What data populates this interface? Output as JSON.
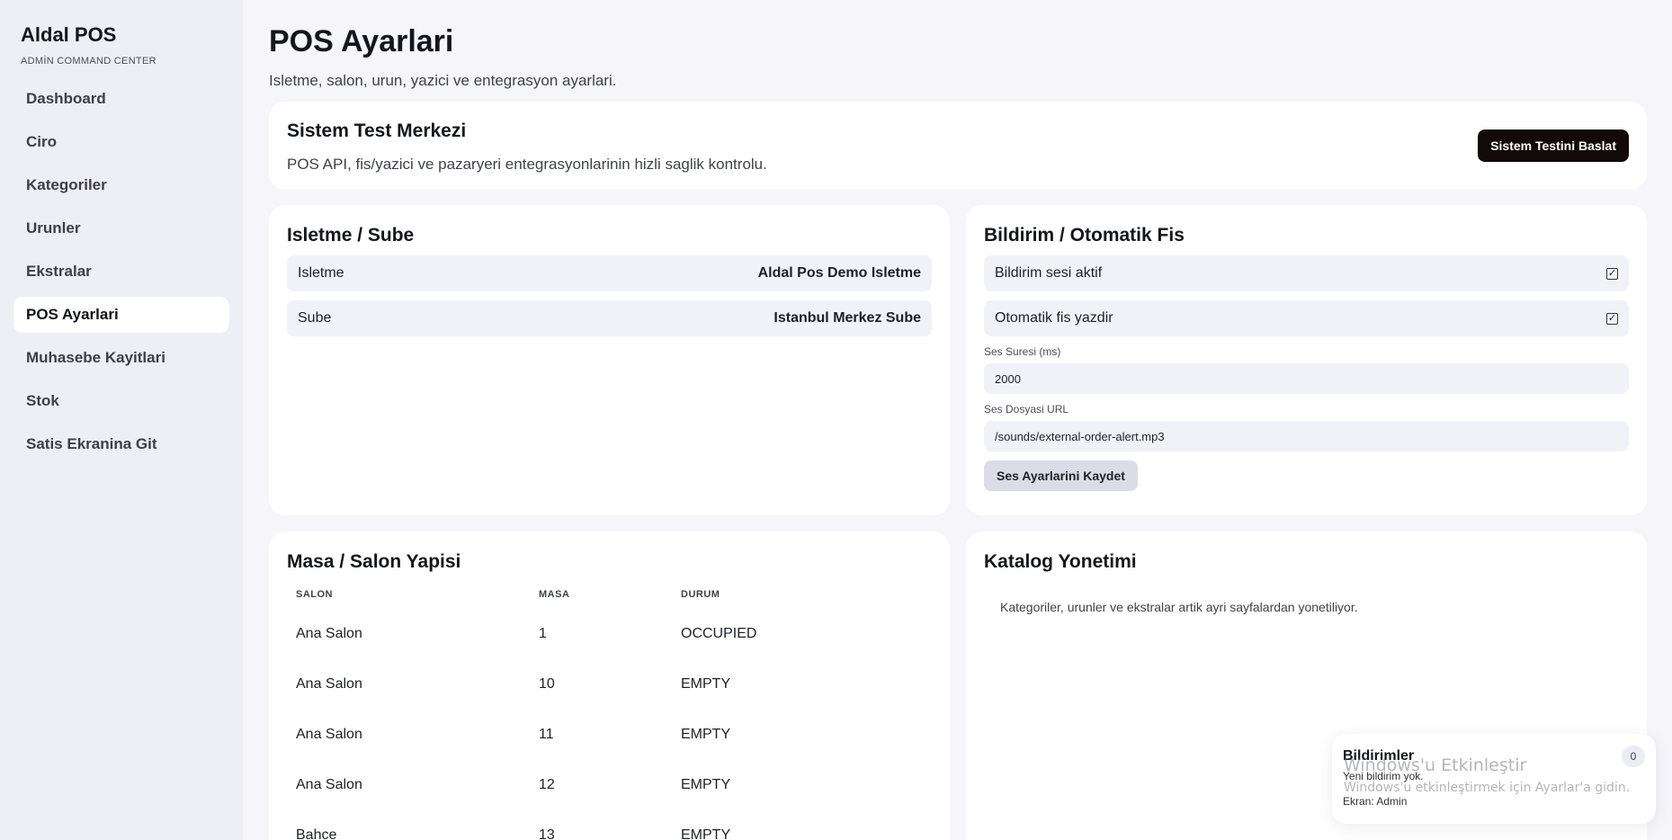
{
  "sidebar": {
    "brand": "Aldal POS",
    "subtitle": "ADMİN COMMAND CENTER",
    "items": [
      {
        "label": "Dashboard"
      },
      {
        "label": "Ciro"
      },
      {
        "label": "Kategoriler"
      },
      {
        "label": "Urunler"
      },
      {
        "label": "Ekstralar"
      },
      {
        "label": "POS Ayarlari"
      },
      {
        "label": "Muhasebe Kayitlari"
      },
      {
        "label": "Stok"
      },
      {
        "label": "Satis Ekranina Git"
      }
    ]
  },
  "header": {
    "title": "POS Ayarlari",
    "subtitle": "Isletme, salon, urun, yazici ve entegrasyon ayarlari."
  },
  "test_center": {
    "title": "Sistem Test Merkezi",
    "description": "POS API, fis/yazici ve pazaryeri entegrasyonlarinin hizli saglik kontrolu.",
    "button": "Sistem Testini Baslat"
  },
  "business": {
    "title": "Isletme / Sube",
    "rows": [
      {
        "label": "Isletme",
        "value": "Aldal Pos Demo Isletme"
      },
      {
        "label": "Sube",
        "value": "Istanbul Merkez Sube"
      }
    ]
  },
  "notification": {
    "title": "Bildirim / Otomatik Fis",
    "options": [
      {
        "label": "Bildirim sesi aktif",
        "checked": true
      },
      {
        "label": "Otomatik fis yazdir",
        "checked": true
      }
    ],
    "duration_label": "Ses Suresi (ms)",
    "duration_value": "2000",
    "url_label": "Ses Dosyasi URL",
    "url_value": "/sounds/external-order-alert.mp3",
    "save_button": "Ses Ayarlarini Kaydet"
  },
  "tables": {
    "title": "Masa / Salon Yapisi",
    "headers": [
      "SALON",
      "MASA",
      "DURUM"
    ],
    "rows": [
      [
        "Ana Salon",
        "1",
        "OCCUPIED"
      ],
      [
        "Ana Salon",
        "10",
        "EMPTY"
      ],
      [
        "Ana Salon",
        "11",
        "EMPTY"
      ],
      [
        "Ana Salon",
        "12",
        "EMPTY"
      ],
      [
        "Bahce",
        "13",
        "EMPTY"
      ]
    ]
  },
  "catalog": {
    "title": "Katalog Yonetimi",
    "text": "Kategoriler, urunler ve ekstralar artik ayri sayfalardan yonetiliyor."
  },
  "notifications_panel": {
    "title": "Bildirimler",
    "count": "0",
    "empty_text": "Yeni bildirim yok.",
    "screen_text": "Ekran: Admin"
  },
  "os_watermark": {
    "title": "Windows'u Etkinleştir",
    "subtitle": "Windows'u etkinleştirmek için Ayarlar'a gidin."
  }
}
